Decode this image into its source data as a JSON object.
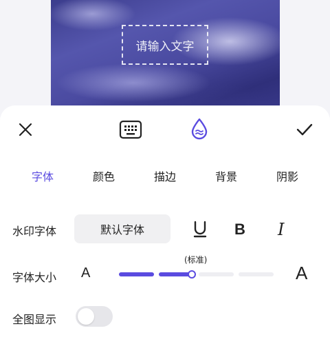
{
  "preview": {
    "placeholder_text": "请输入文字"
  },
  "toolbar": {
    "close_icon": "close-icon",
    "keyboard_icon": "keyboard-icon",
    "style_icon": "ink-drop-icon",
    "confirm_icon": "check-icon"
  },
  "tabs": [
    {
      "label": "字体",
      "active": true
    },
    {
      "label": "颜色",
      "active": false
    },
    {
      "label": "描边",
      "active": false
    },
    {
      "label": "背景",
      "active": false
    },
    {
      "label": "阴影",
      "active": false
    }
  ],
  "font_row": {
    "label": "水印字体",
    "selected_font": "默认字体",
    "underline_icon": "underline-icon",
    "bold_label": "B",
    "italic_label": "I"
  },
  "size_row": {
    "label": "字体大小",
    "small_glyph": "A",
    "large_glyph": "A",
    "level_label": "(标准)",
    "level": 2,
    "levels": 4
  },
  "fullscreen_row": {
    "label": "全图显示",
    "enabled": false
  },
  "colors": {
    "accent": "#5a4be0"
  }
}
